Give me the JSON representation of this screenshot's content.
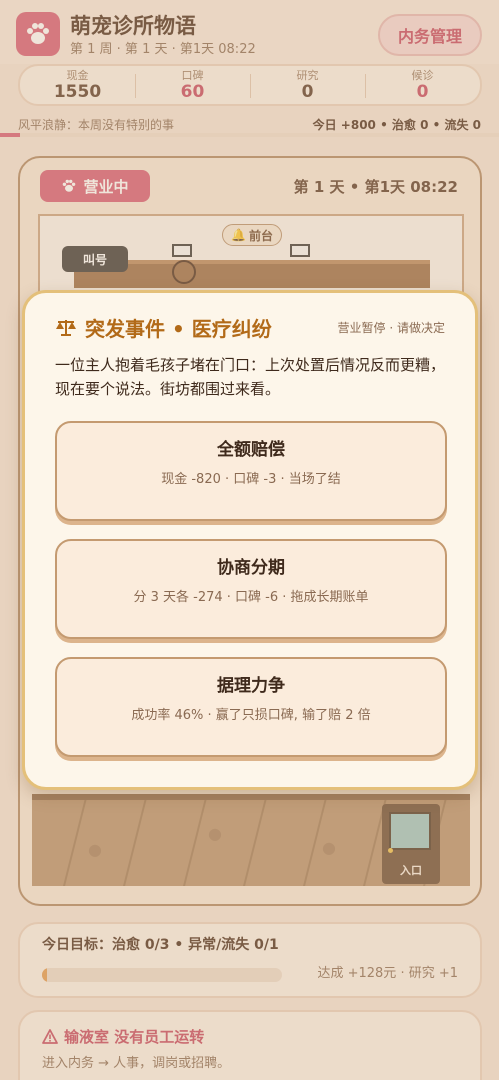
{
  "app": {
    "title": "萌宠诊所物语",
    "subtitle": "第 1 周 · 第 1 天 · 第1天 08:22",
    "admin_button": "内务管理",
    "logo_icon": "paw-icon"
  },
  "stats": [
    {
      "label": "现金",
      "value": "1550",
      "color": "#5a3a26"
    },
    {
      "label": "口碑",
      "value": "60",
      "color": "#c7455f"
    },
    {
      "label": "研究",
      "value": "0",
      "color": "#5a3a26"
    },
    {
      "label": "候诊",
      "value": "0",
      "color": "#c7455f"
    }
  ],
  "status_line": {
    "event": "风平浪静：本周没有特别的事",
    "today": "今日 +800 • 治愈 0 • 流失 0",
    "day_progress": 0.04
  },
  "main": {
    "open_badge": "营业中",
    "time": "第 1 天 • 第1天 08:22",
    "front_desk": "前台",
    "call_button": "叫号",
    "entrance": "入口"
  },
  "modal": {
    "title": "突发事件 • 医疗纠纷",
    "status": "营业暂停 · 请做决定",
    "description": "一位主人抱着毛孩子堵在门口：上次处置后情况反而更糟，现在要个说法。街坊都围过来看。",
    "choices": [
      {
        "title": "全额赔偿",
        "detail": "现金 -820 · 口碑 -3 · 当场了结"
      },
      {
        "title": "协商分期",
        "detail": "分 3 天各 -274 · 口碑 -6 · 拖成长期账单"
      },
      {
        "title": "据理力争",
        "detail": "成功率 46% · 赢了只损口碑, 输了赔 2 倍"
      }
    ]
  },
  "goal": {
    "title": "今日目标：治愈 0/3 • 异常/流失 0/1",
    "reward": "达成 +128元 · 研究 +1",
    "progress": 0.02
  },
  "warning": {
    "title": "输液室 没有员工运转",
    "description": "进入内务 → 人事，调岗或招聘。"
  }
}
